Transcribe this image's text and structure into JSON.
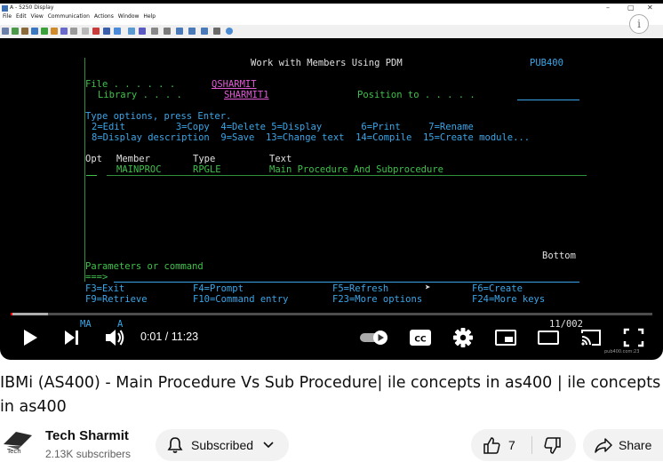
{
  "emulator": {
    "window_title": "A - 5250 Display",
    "menu": [
      "File",
      "Edit",
      "View",
      "Communication",
      "Actions",
      "Window",
      "Help"
    ]
  },
  "terminal": {
    "screen_title": "Work with Members Using PDM",
    "system_name": "PUB400",
    "file_label": "File . . . . . .",
    "file_value": "QSHARMIT",
    "library_label": "Library . . . .",
    "library_value": "SHARMIT1",
    "position_label": "Position to . . . . .",
    "instructions": "Type options, press Enter.",
    "options_line1": "2=Edit         3=Copy  4=Delete 5=Display       6=Print     7=Rename",
    "options_line2": "8=Display description  9=Save  13=Change text  14=Compile  15=Create module...",
    "col_opt": "Opt",
    "col_member": "Member",
    "col_type": "Type",
    "col_text": "Text",
    "row_member": "MAINPROC",
    "row_type": "RPGLE",
    "row_text": "Main Procedure And Subprocedure",
    "bottom_label": "Bottom",
    "params_label": "Parameters or command",
    "prompt": "===>",
    "fkeys_line1_a": "F3=Exit",
    "fkeys_line1_b": "F4=Prompt",
    "fkeys_line1_c": "F5=Refresh",
    "fkeys_line1_d": "F6=Create",
    "fkeys_line2_a": "F9=Retrieve",
    "fkeys_line2_b": "F10=Command entry",
    "fkeys_line2_c": "F23=More options",
    "fkeys_line2_d": "F24=More keys",
    "status_left": "MA",
    "status_mid": "A",
    "status_right": "11/002"
  },
  "player": {
    "time_current": "0:01",
    "time_total": "11:23",
    "time_display": "0:01 / 11:23",
    "cc_label": "CC",
    "watermark": "pub400.com:23"
  },
  "video": {
    "title": "IBMi (AS400) - Main Procedure Vs Sub Procedure| ile concepts in as400 | ile concepts in as400"
  },
  "channel": {
    "name": "Tech Sharmit",
    "subscribers": "2.13K subscribers",
    "avatar_text": "Tech"
  },
  "actions": {
    "subscribed_label": "Subscribed",
    "like_count": "7",
    "share_label": "Share"
  },
  "colors": {
    "progress_played": "#ff0000",
    "terminal_green": "#3ec24a",
    "terminal_cyan": "#3aa6e8",
    "terminal_pink": "#e05ad6"
  }
}
